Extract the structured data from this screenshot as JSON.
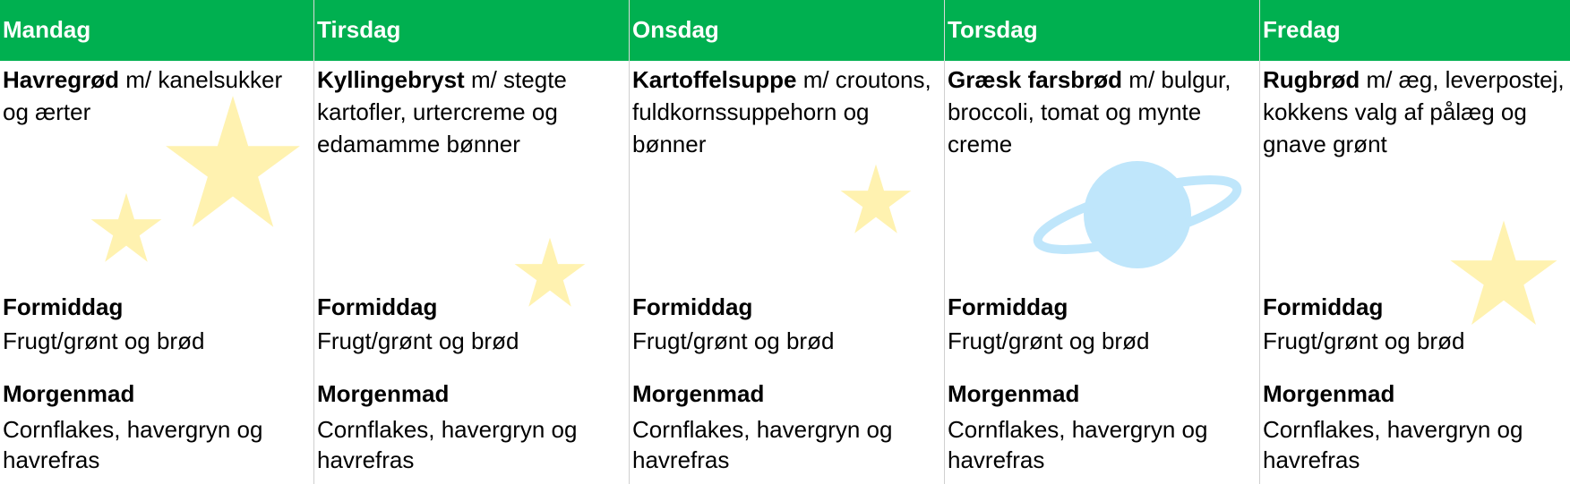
{
  "colors": {
    "header_bg": "#00b050",
    "header_text": "#ffffff",
    "star": "#fff2b0",
    "planet": "#bfe6fb"
  },
  "days": [
    {
      "name": "Mandag",
      "lunch_dish": "Havregrød",
      "lunch_rest": " m/ kanelsukker og ærter",
      "snack_label": "Formiddag",
      "snack_text": "Frugt/grønt og brød",
      "breakfast_label": "Morgenmad",
      "breakfast_text": "Cornflakes, havergryn og havrefras"
    },
    {
      "name": "Tirsdag",
      "lunch_dish": "Kyllingebryst",
      "lunch_rest": " m/ stegte kartofler, urtercreme og edamamme bønner",
      "snack_label": "Formiddag",
      "snack_text": "Frugt/grønt og brød",
      "breakfast_label": "Morgenmad",
      "breakfast_text": "Cornflakes, havergryn og havrefras"
    },
    {
      "name": "Onsdag",
      "lunch_dish": "Kartoffelsuppe",
      "lunch_rest": " m/ croutons, fuldkornssuppehorn og bønner",
      "snack_label": "Formiddag",
      "snack_text": "Frugt/grønt og brød",
      "breakfast_label": "Morgenmad",
      "breakfast_text": "Cornflakes, havergryn og havrefras"
    },
    {
      "name": "Torsdag",
      "lunch_dish": "Græsk farsbrød",
      "lunch_rest": " m/ bulgur, broccoli, tomat og mynte creme",
      "snack_label": "Formiddag",
      "snack_text": "Frugt/grønt og brød",
      "breakfast_label": "Morgenmad",
      "breakfast_text": "Cornflakes, havergryn og havrefras"
    },
    {
      "name": "Fredag",
      "lunch_dish": "Rugbrød",
      "lunch_rest": " m/ æg, leverpostej, kokkens valg af pålæg og gnave grønt",
      "snack_label": "Formiddag",
      "snack_text": "Frugt/grønt og brød",
      "breakfast_label": "Morgenmad",
      "breakfast_text": "Cornflakes, havergryn og havrefras"
    }
  ]
}
